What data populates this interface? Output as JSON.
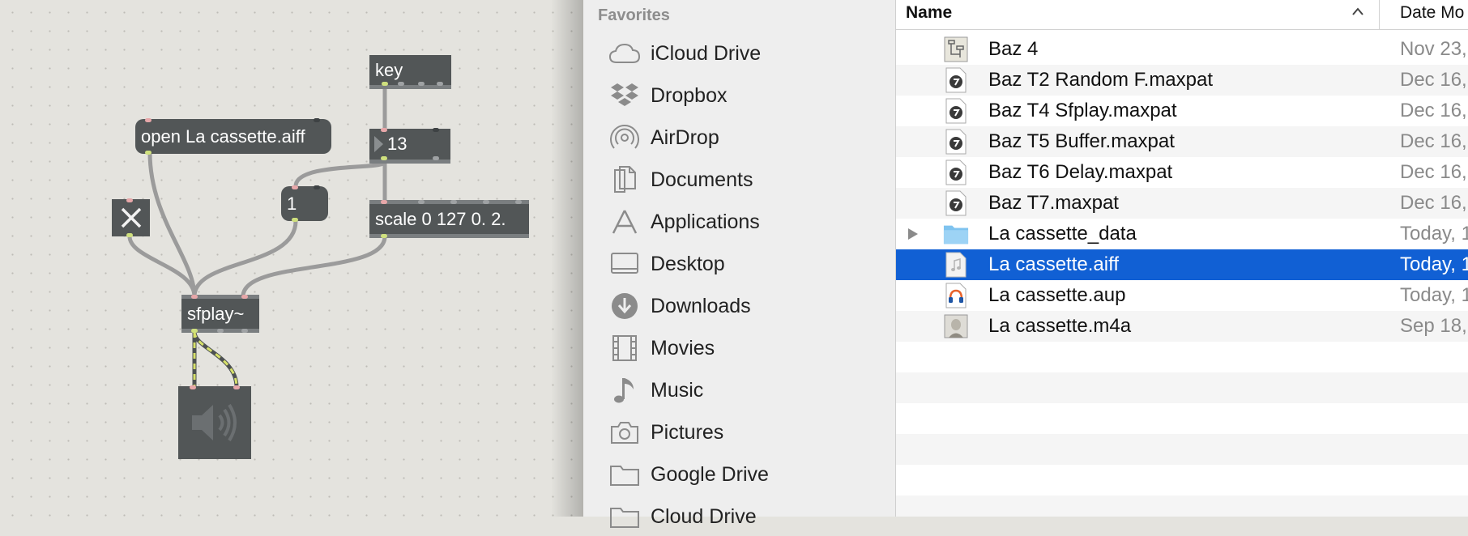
{
  "patcher": {
    "objects": {
      "key": "key",
      "number": "13",
      "message_open": "open La cassette.aiff",
      "message_one": "1",
      "scale": "scale 0 127 0. 2.",
      "sfplay": "sfplay~"
    },
    "icons": {
      "toggle": "x-icon",
      "speaker": "speaker-icon"
    },
    "colors": {
      "object_bg": "#525657",
      "inlet": "#e7a7a9",
      "outlet": "#cfe07e",
      "signal_cable": "#d6e06a"
    }
  },
  "sidebar": {
    "heading": "Favorites",
    "items": [
      {
        "label": "iCloud Drive",
        "icon": "cloud-icon"
      },
      {
        "label": "Dropbox",
        "icon": "dropbox-icon"
      },
      {
        "label": "AirDrop",
        "icon": "airdrop-icon"
      },
      {
        "label": "Documents",
        "icon": "documents-icon"
      },
      {
        "label": "Applications",
        "icon": "applications-icon"
      },
      {
        "label": "Desktop",
        "icon": "desktop-icon"
      },
      {
        "label": "Downloads",
        "icon": "downloads-icon"
      },
      {
        "label": "Movies",
        "icon": "movies-icon"
      },
      {
        "label": "Music",
        "icon": "music-icon"
      },
      {
        "label": "Pictures",
        "icon": "pictures-icon"
      },
      {
        "label": "Google Drive",
        "icon": "folder-icon"
      },
      {
        "label": "Cloud Drive",
        "icon": "folder-icon"
      }
    ]
  },
  "filelist": {
    "columns": {
      "name": "Name",
      "date": "Date Mo"
    },
    "rows": [
      {
        "name": "Baz 4",
        "date": "Nov 23,",
        "icon": "patcher-doc-icon"
      },
      {
        "name": "Baz T2 Random F.maxpat",
        "date": "Dec 16,",
        "icon": "maxpat-icon"
      },
      {
        "name": "Baz T4 Sfplay.maxpat",
        "date": "Dec 16,",
        "icon": "maxpat-icon"
      },
      {
        "name": "Baz T5 Buffer.maxpat",
        "date": "Dec 16,",
        "icon": "maxpat-icon"
      },
      {
        "name": "Baz T6 Delay.maxpat",
        "date": "Dec 16,",
        "icon": "maxpat-icon"
      },
      {
        "name": "Baz T7.maxpat",
        "date": "Dec 16,",
        "icon": "maxpat-icon"
      },
      {
        "name": "La cassette_data",
        "date": "Today, 1",
        "icon": "folder-icon",
        "disclosure": true
      },
      {
        "name": "La cassette.aiff",
        "date": "Today, 1",
        "icon": "audio-file-icon",
        "selected": true
      },
      {
        "name": "La cassette.aup",
        "date": "Today, 1",
        "icon": "audacity-icon"
      },
      {
        "name": "La cassette.m4a",
        "date": "Sep 18,",
        "icon": "m4a-thumbnail-icon"
      }
    ],
    "colors": {
      "selection": "#1160d4",
      "stripe": "#f5f5f5"
    }
  }
}
